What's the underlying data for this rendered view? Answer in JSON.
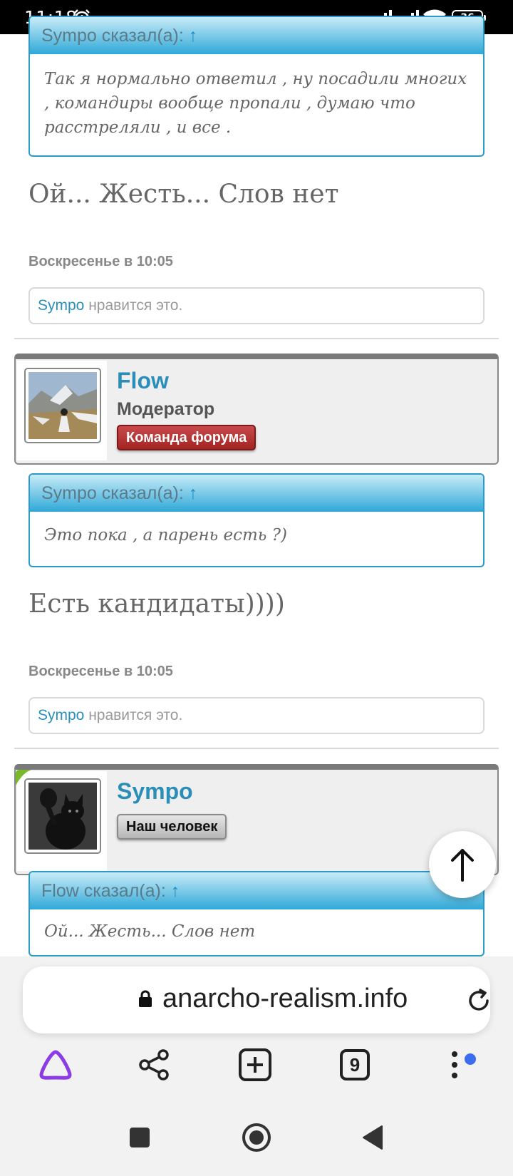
{
  "status_bar": {
    "time": "11:18",
    "battery": "36"
  },
  "posts": [
    {
      "quote_author_label": "Sympo сказал(а):",
      "quote_arrow": "↑",
      "quote_text": "Так я нормально ответил , ну посадили многих , командиры вообще пропали , думаю что расстреляли , и все .",
      "message": "Ой... Жесть... Слов нет",
      "date": "Воскресенье в 10:05",
      "likes_user": "Sympo",
      "likes_text": " нравится это."
    },
    {
      "user": {
        "name": "Flow",
        "title": "Модератор",
        "badge": "Команда форума"
      },
      "quote_author_label": "Sympo сказал(а):",
      "quote_arrow": "↑",
      "quote_text": "Это пока , а парень есть ?)",
      "message": "Есть кандидаты))))",
      "date": "Воскресенье в 10:05",
      "likes_user": "Sympo",
      "likes_text": " нравится это."
    },
    {
      "user": {
        "name": "Sympo",
        "badge": "Наш человек"
      },
      "quote_author_label": "Flow сказал(а):",
      "quote_arrow": "↑",
      "quote_text": "Ой... Жесть... Слов нет"
    }
  ],
  "browser": {
    "url": "anarcho-realism.info",
    "tab_count": "9"
  },
  "colors": {
    "link": "#2a8fb8",
    "quote_border": "#2a9ac8",
    "badge_staff": "#b22d2d",
    "notification_dot": "#3c6df0",
    "alice_purple": "#8b3be8"
  },
  "icons": [
    "alarm-icon",
    "signal-icon",
    "wifi-icon",
    "battery-icon",
    "lock-icon",
    "reload-icon",
    "alice-icon",
    "share-icon",
    "new-tab-icon",
    "tabs-icon",
    "more-icon",
    "scroll-top-icon",
    "square-nav-icon",
    "home-nav-icon",
    "back-nav-icon"
  ]
}
